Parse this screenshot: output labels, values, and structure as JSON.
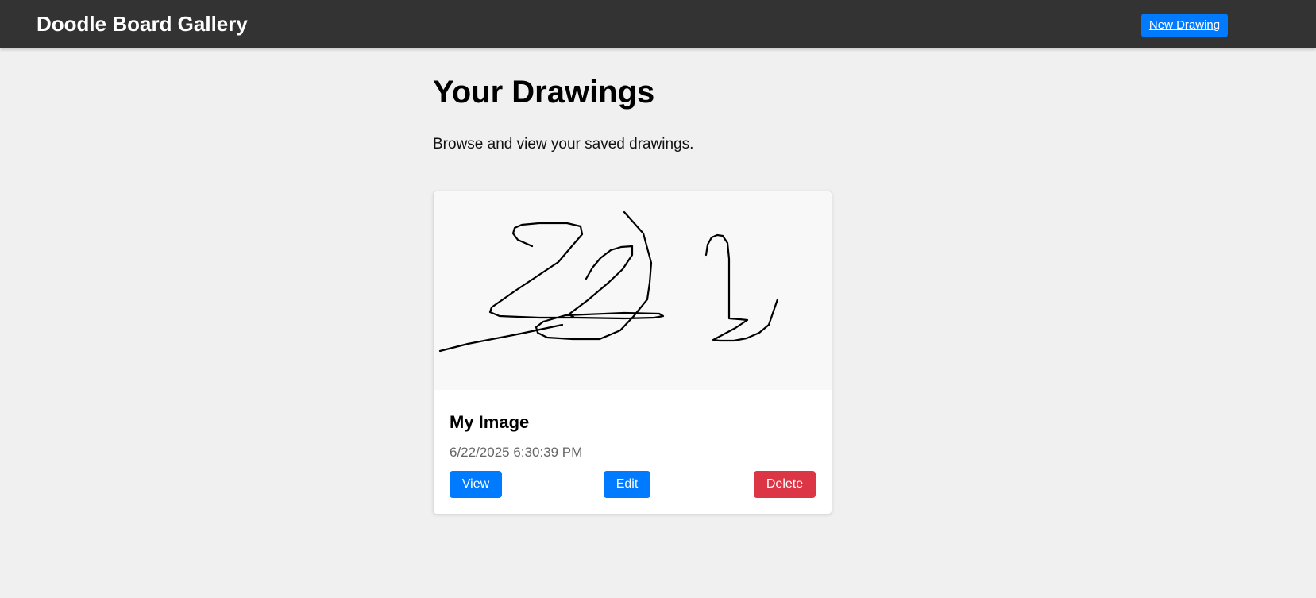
{
  "header": {
    "title": "Doodle Board Gallery",
    "new_drawing_label": "New Drawing"
  },
  "main": {
    "title": "Your Drawings",
    "subtitle": "Browse and view your saved drawings."
  },
  "drawings": [
    {
      "name": "My Image",
      "date": "6/22/2025 6:30:39 PM",
      "view_label": "View",
      "edit_label": "Edit",
      "delete_label": "Delete"
    }
  ],
  "colors": {
    "header_bg": "#333333",
    "primary": "#007bff",
    "danger": "#dc3545",
    "page_bg": "#f0f0f0"
  }
}
